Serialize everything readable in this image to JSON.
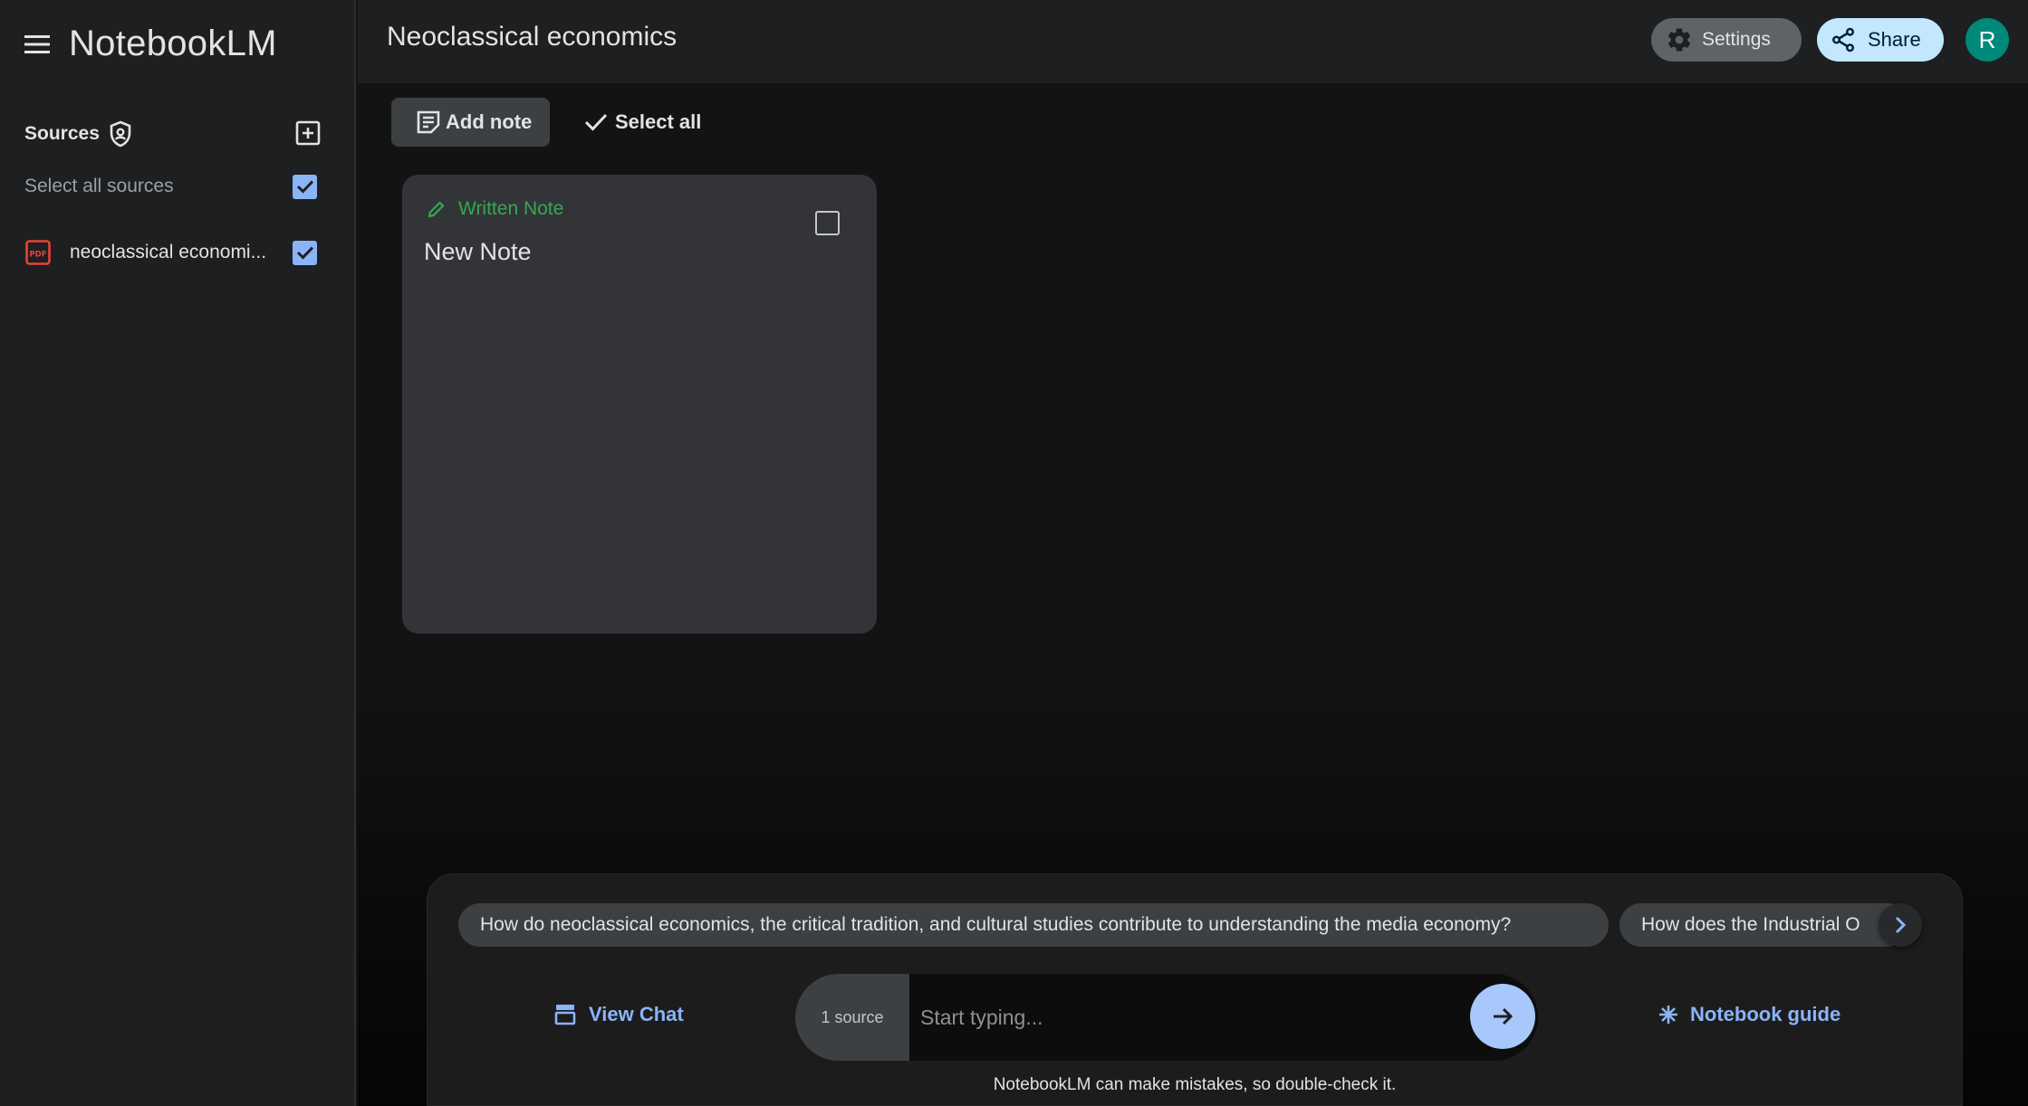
{
  "app": {
    "name": "NotebookLM"
  },
  "sidebar": {
    "sources_title": "Sources",
    "select_all_label": "Select all sources",
    "sources": [
      {
        "name": "neoclassical economics.pdf",
        "display": "neoclassical economi...",
        "type": "pdf",
        "checked": true
      }
    ]
  },
  "header": {
    "title": "Neoclassical economics",
    "settings_label": "Settings",
    "share_label": "Share",
    "avatar_initial": "R"
  },
  "toolbar": {
    "add_note_label": "Add note",
    "select_all_label": "Select all"
  },
  "notes": [
    {
      "type_label": "Written Note",
      "title": "New Note",
      "checked": false
    }
  ],
  "chat": {
    "suggestions": [
      "How do neoclassical economics, the critical tradition, and cultural studies contribute to understanding the media economy?",
      "How does the Industrial O"
    ],
    "view_chat_label": "View Chat",
    "source_count_label": "1 source",
    "input_placeholder": "Start typing...",
    "guide_label": "Notebook guide",
    "disclaimer": "NotebookLM can make mistakes, so double-check it."
  },
  "colors": {
    "accent_blue": "#8ab4f8",
    "note_green": "#34a853",
    "pdf_red": "#ea4335",
    "avatar_teal": "#00897b"
  },
  "icons": [
    "menu-icon",
    "shield-icon",
    "add-box-icon",
    "check-icon",
    "pdf-icon",
    "gear-icon",
    "share-icon",
    "note-icon",
    "pencil-icon",
    "chevron-right-icon",
    "chat-icon",
    "arrow-right-icon",
    "sparkle-icon"
  ]
}
